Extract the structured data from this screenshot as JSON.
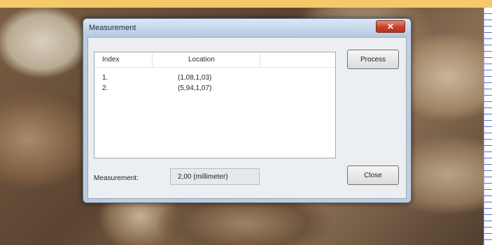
{
  "dialog": {
    "title": "Measurement",
    "close_glyph": "✕",
    "list": {
      "columns": [
        "Index",
        "Location"
      ],
      "rows": [
        {
          "index": "1.",
          "location": "(1,08,1,03)"
        },
        {
          "index": "2.",
          "location": "(5,94,1,07)"
        }
      ]
    },
    "process_label": "Process",
    "close_label": "Close",
    "measurement_label": "Measurement:",
    "measurement_value": "2,00 (millimeter)"
  },
  "colors": {
    "top_bar": "#f5c86a",
    "close_button": "#c5422e"
  }
}
